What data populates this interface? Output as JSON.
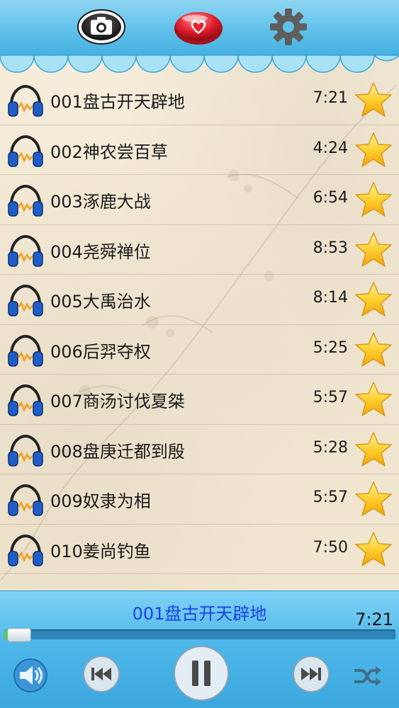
{
  "toolbar": {
    "camera_icon": "camera-icon",
    "favorites_icon": "heart-icon",
    "settings_icon": "gear-icon"
  },
  "tracks": [
    {
      "title": "001盘古开天辟地",
      "duration": "7:21"
    },
    {
      "title": "002神农尝百草",
      "duration": "4:24"
    },
    {
      "title": "003涿鹿大战",
      "duration": "6:54"
    },
    {
      "title": "004尧舜禅位",
      "duration": "8:53"
    },
    {
      "title": "005大禹治水",
      "duration": "8:14"
    },
    {
      "title": "006后羿夺权",
      "duration": "5:25"
    },
    {
      "title": "007商汤讨伐夏桀",
      "duration": "5:57"
    },
    {
      "title": "008盘庚迁都到殷",
      "duration": "5:28"
    },
    {
      "title": "009奴隶为相",
      "duration": "5:57"
    },
    {
      "title": "010姜尚钓鱼",
      "duration": "7:50"
    }
  ],
  "player": {
    "now_playing_title": "001盘古开天辟地",
    "now_playing_time": "7:21",
    "progress_fraction": 0.01
  },
  "colors": {
    "bar_blue": "#4fb8ea",
    "now_playing_text": "#1a43e6",
    "progress_fill": "#58d04a"
  }
}
